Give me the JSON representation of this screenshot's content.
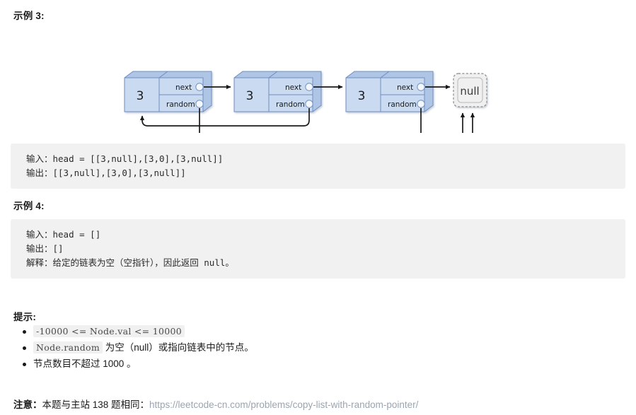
{
  "page": {
    "example3_title": "示例 3:",
    "example4_title": "示例 4:",
    "hints_title": "提示:"
  },
  "diagram": {
    "node_value": "3",
    "next_label": "next",
    "random_label": "random",
    "null_label": "null",
    "nodes": [
      {
        "value": "3",
        "next": "node2",
        "random": "null"
      },
      {
        "value": "3",
        "next": "node3",
        "random": "node1"
      },
      {
        "value": "3",
        "next": "null",
        "random": "null"
      }
    ],
    "colors": {
      "node_face": "#c9daf1",
      "node_top": "#aec5e6",
      "node_border": "#6f8fc0",
      "null_fill": "#f0f0f0",
      "arrow": "#1a1a1a"
    }
  },
  "example3_code": {
    "lines": [
      "输入：head = [[3,null],[3,0],[3,null]]",
      "输出：[[3,null],[3,0],[3,null]]"
    ]
  },
  "example4_code": {
    "lines": [
      "输入：head = []",
      "输出：[]",
      "解释：给定的链表为空（空指针），因此返回 null。"
    ]
  },
  "hints": {
    "items": [
      {
        "code": "-10000 <= Node.val <= 10000",
        "text": ""
      },
      {
        "code": "Node.random",
        "text": " 为空（null）或指向链表中的节点。"
      },
      {
        "code": "",
        "text": "节点数目不超过 1000 。"
      }
    ]
  },
  "footnote": {
    "label": "注意：",
    "text": "本题与主站 138 题相同：",
    "link": "https://leetcode-cn.com/problems/copy-list-with-random-pointer/"
  }
}
